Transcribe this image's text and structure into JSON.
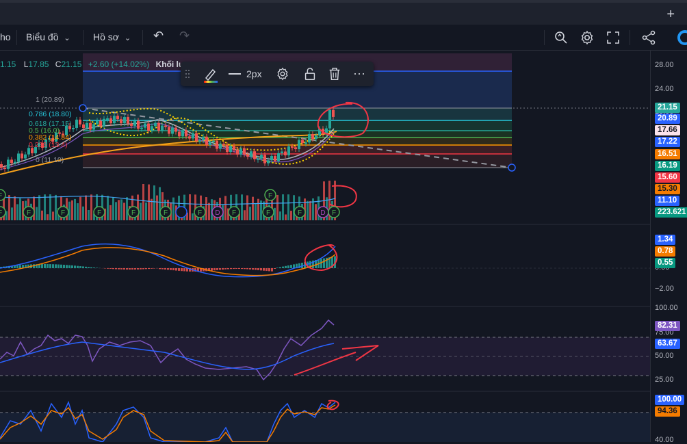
{
  "topbar": {
    "plus": "+"
  },
  "toolbar": {
    "partial_left": "ho",
    "chart_menu": "Biểu đồ",
    "profile_menu": "Hồ sơ",
    "chevron": "⌄",
    "undo": "↶",
    "redo": "↷"
  },
  "ohlc": {
    "o": "1.15",
    "l_label": "L",
    "l": "17.85",
    "c_label": "C",
    "c": "21.15",
    "change": "+2.60 (+14.02%)",
    "volume_label": "Khối lư"
  },
  "drawing_toolbar": {
    "width_label": "2px",
    "more": "···"
  },
  "fib_levels": [
    {
      "label": "1 (20.89)",
      "color": "#9598a1"
    },
    {
      "label": "0.786 (18.80)",
      "color": "#26c6da"
    },
    {
      "label": "0.618 (17.15)",
      "color": "#26a69a"
    },
    {
      "label": "0.5 (16.0)",
      "color": "#4caf50"
    },
    {
      "label": "0.382 (14.84)",
      "color": "#ff9800"
    },
    {
      "label": "0.236 (13.4)",
      "color": "#f23645"
    },
    {
      "label": "0 (11.10)",
      "color": "#9598a1"
    }
  ],
  "price_axis": {
    "ticks": [
      "28.00",
      "24.00",
      "20.00"
    ],
    "tags": [
      {
        "text": "21.15",
        "bg": "#26a69a",
        "fg": "#ffffff"
      },
      {
        "text": "20.89",
        "bg": "#2962ff",
        "fg": "#ffffff"
      },
      {
        "text": "17.66",
        "bg": "#fce4ec",
        "fg": "#131722"
      },
      {
        "text": "17.22",
        "bg": "#2962ff",
        "fg": "#ffffff"
      },
      {
        "text": "16.51",
        "bg": "#f57c00",
        "fg": "#ffffff"
      },
      {
        "text": "16.19",
        "bg": "#089981",
        "fg": "#ffffff"
      },
      {
        "text": "15.60",
        "bg": "#f23645",
        "fg": "#ffffff"
      },
      {
        "text": "15.30",
        "bg": "#f57c00",
        "fg": "#131722"
      },
      {
        "text": "11.10",
        "bg": "#2962ff",
        "fg": "#ffffff"
      },
      {
        "text": "223.621",
        "bg": "#089981",
        "fg": "#ffffff"
      }
    ]
  },
  "macd_axis": {
    "ticks": [
      "0.00",
      "−2.00"
    ],
    "tags": [
      {
        "text": "1.34",
        "bg": "#2962ff",
        "fg": "#ffffff"
      },
      {
        "text": "0.78",
        "bg": "#f57c00",
        "fg": "#ffffff"
      },
      {
        "text": "0.55",
        "bg": "#089981",
        "fg": "#ffffff"
      }
    ]
  },
  "rsi_axis": {
    "ticks": [
      "100.00",
      "75.00",
      "50.00",
      "25.00"
    ],
    "tags": [
      {
        "text": "82.31",
        "bg": "#7e57c2",
        "fg": "#ffffff"
      },
      {
        "text": "63.67",
        "bg": "#2962ff",
        "fg": "#ffffff"
      }
    ]
  },
  "stoch_axis": {
    "ticks": [
      "40.00"
    ],
    "tags": [
      {
        "text": "100.00",
        "bg": "#2962ff",
        "fg": "#ffffff"
      },
      {
        "text": "94.36",
        "bg": "#f57c00",
        "fg": "#131722"
      }
    ]
  },
  "markers": {
    "F": "F",
    "D": "D"
  },
  "colors": {
    "up": "#26a69a",
    "down": "#ef5350",
    "bg": "#131722",
    "accent": "#2962ff"
  }
}
